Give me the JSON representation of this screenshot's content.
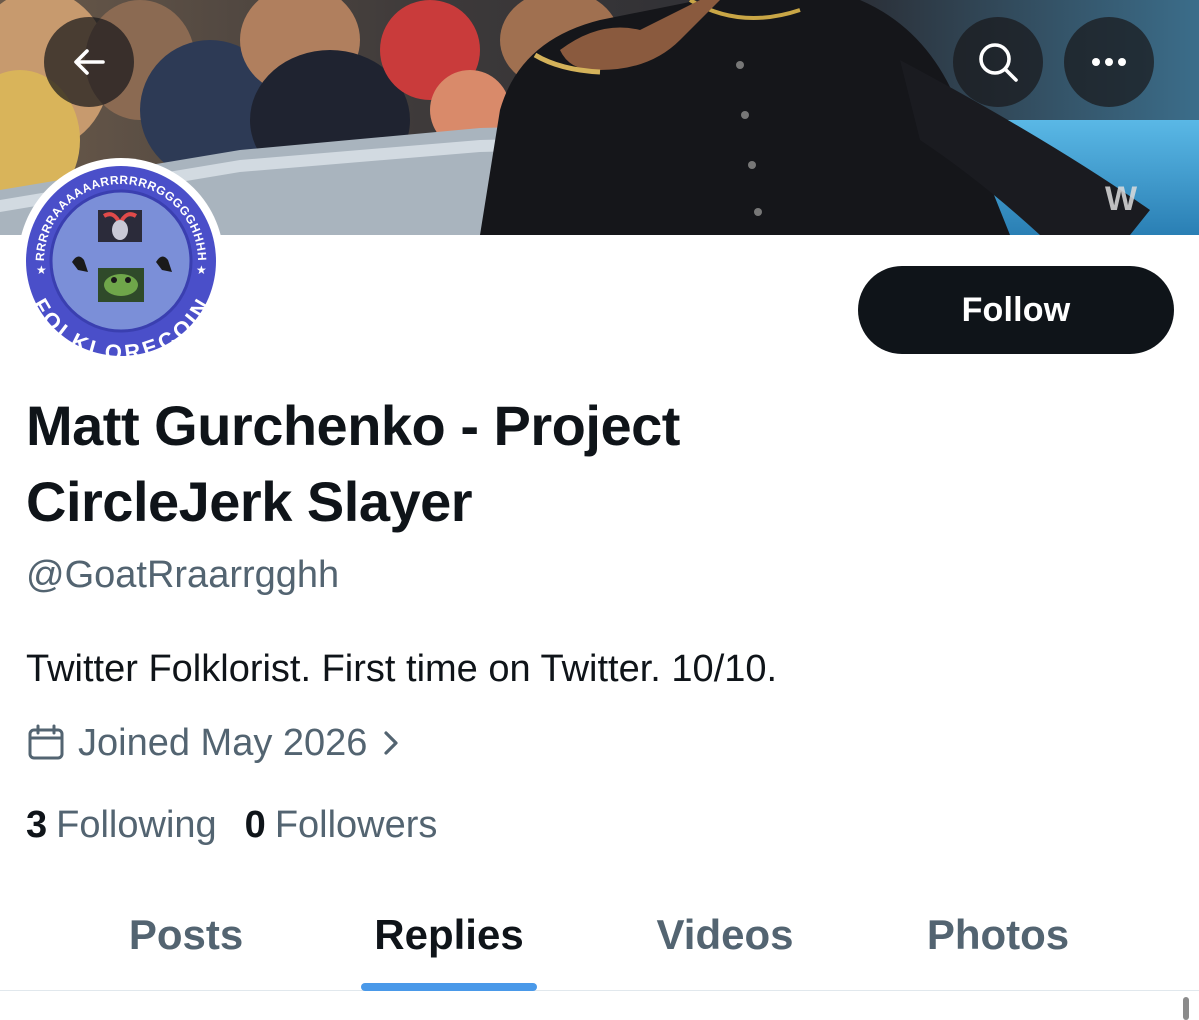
{
  "header": {
    "back_icon": "back-arrow-icon",
    "search_icon": "search-icon",
    "more_icon": "more-dots-icon"
  },
  "banner": {
    "watermark": "W"
  },
  "avatar": {
    "badge_top_text": "RRRRRAAAAAARRRRRRGGGGGHHHH",
    "badge_bottom_text": "FOLKLORECOIN",
    "ring_color": "#4a4fc9",
    "fill_color": "#7b8fd8"
  },
  "profile": {
    "follow_label": "Follow",
    "display_name": "Matt Gurchenko - Project CircleJerk Slayer",
    "handle": "@GoatRraarrgghh",
    "bio": "Twitter Folklorist. First time on Twitter. 10/10.",
    "joined": "Joined May 2026",
    "following_count": "3",
    "following_label": "Following",
    "followers_count": "0",
    "followers_label": "Followers"
  },
  "tabs": [
    {
      "label": "Posts",
      "active": false
    },
    {
      "label": "Replies",
      "active": true
    },
    {
      "label": "Videos",
      "active": false
    },
    {
      "label": "Photos",
      "active": false
    }
  ],
  "colors": {
    "text_primary": "#0f1419",
    "text_secondary": "#536471",
    "accent": "#4a99e9",
    "follow_bg": "#0f1419"
  }
}
